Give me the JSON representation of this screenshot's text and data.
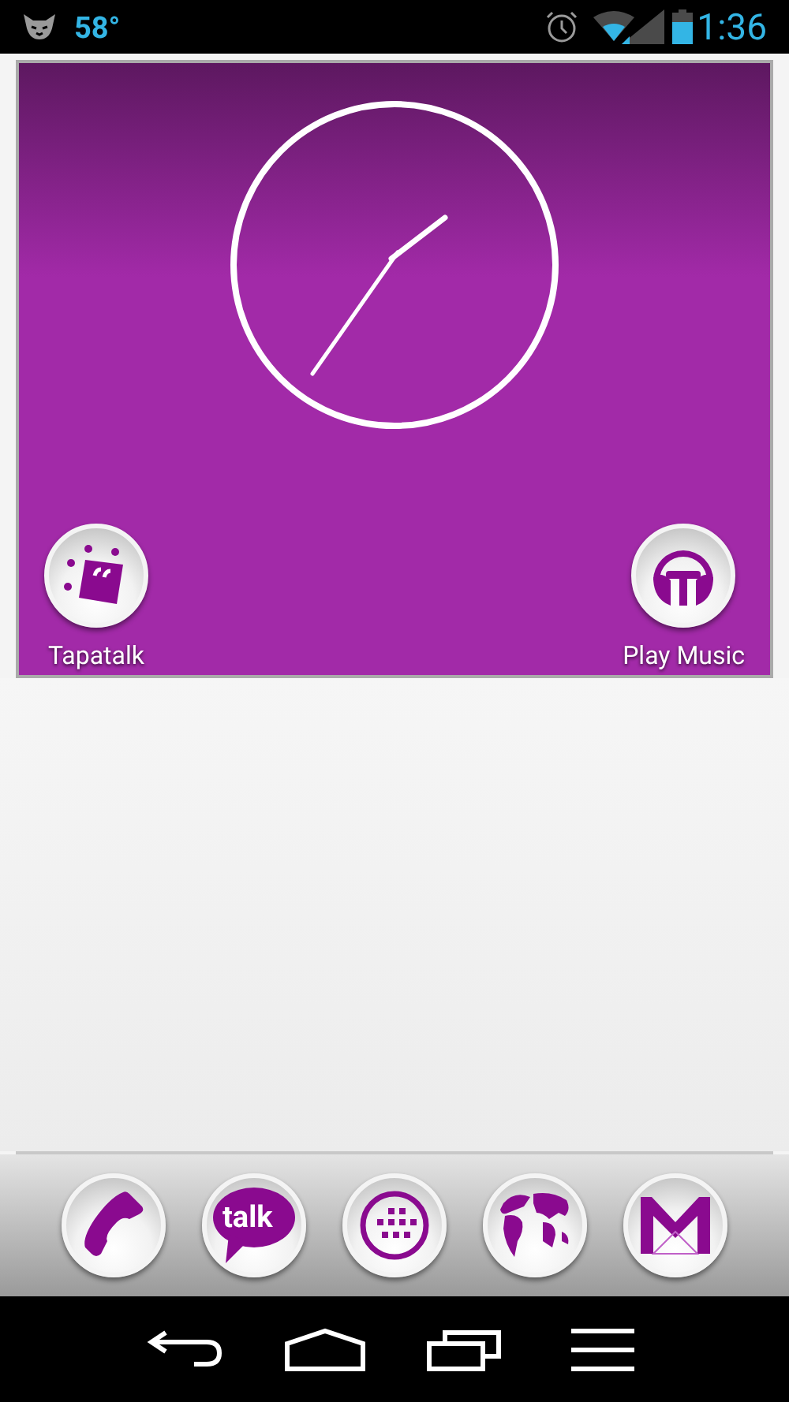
{
  "status_bar": {
    "temperature": "58°",
    "time": "1:36"
  },
  "widget": {
    "kind": "analog-clock",
    "shortcuts": [
      {
        "kind": "tapatalk",
        "label": "Tapatalk"
      },
      {
        "kind": "music",
        "label": "Play Music"
      }
    ]
  },
  "dock": [
    {
      "kind": "phone"
    },
    {
      "kind": "talk",
      "label": "talk"
    },
    {
      "kind": "apps"
    },
    {
      "kind": "browser"
    },
    {
      "kind": "gmail"
    }
  ],
  "nav_bar": [
    {
      "kind": "back"
    },
    {
      "kind": "home"
    },
    {
      "kind": "recents"
    },
    {
      "kind": "menu"
    }
  ]
}
